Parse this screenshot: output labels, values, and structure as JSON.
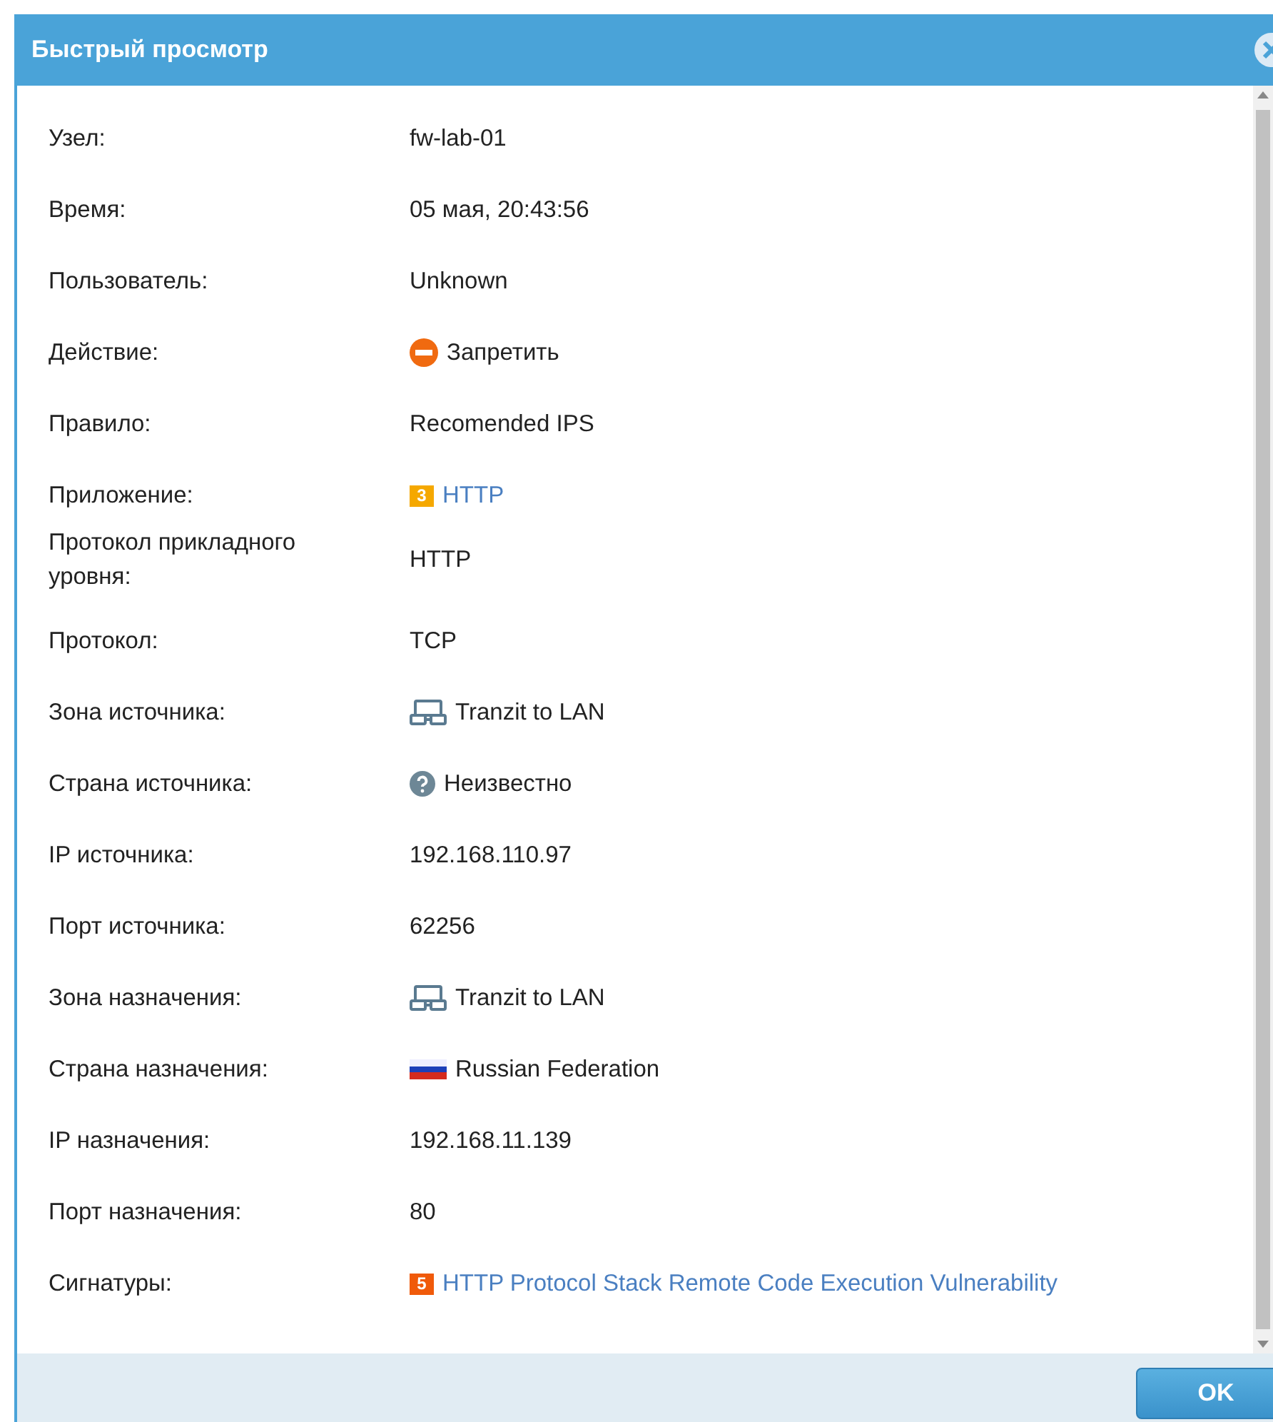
{
  "dialog": {
    "title": "Быстрый просмотр"
  },
  "fields": [
    {
      "label": "Узел:",
      "kind": "text",
      "value": "fw-lab-01"
    },
    {
      "label": "Время:",
      "kind": "text",
      "value": "05 мая, 20:43:56"
    },
    {
      "label": "Пользователь:",
      "kind": "text",
      "value": "Unknown"
    },
    {
      "label": "Действие:",
      "kind": "deny",
      "value": "Запретить"
    },
    {
      "label": "Правило:",
      "kind": "text",
      "value": "Recomended IPS"
    },
    {
      "label": "Приложение:",
      "kind": "link",
      "badge": "3",
      "color": "#f5a800",
      "value": "HTTP"
    },
    {
      "label": "Протокол прикладного уровня:",
      "kind": "text",
      "value": "HTTP"
    },
    {
      "label": "Протокол:",
      "kind": "text",
      "value": "TCP"
    },
    {
      "label": "Зона источника:",
      "kind": "zone",
      "value": "Tranzit to LAN"
    },
    {
      "label": "Страна источника:",
      "kind": "unknown",
      "value": "Неизвестно"
    },
    {
      "label": "IP источника:",
      "kind": "text",
      "value": "192.168.110.97"
    },
    {
      "label": "Порт источника:",
      "kind": "text",
      "value": "62256"
    },
    {
      "label": "Зона назначения:",
      "kind": "zone",
      "value": "Tranzit to LAN"
    },
    {
      "label": "Страна назначения:",
      "kind": "flag",
      "value": "Russian Federation"
    },
    {
      "label": "IP назначения:",
      "kind": "text",
      "value": "192.168.11.139"
    },
    {
      "label": "Порт назначения:",
      "kind": "text",
      "value": "80"
    },
    {
      "label": "Сигнатуры:",
      "kind": "link",
      "badge": "5",
      "color": "#f05a0a",
      "value": "HTTP Protocol Stack Remote Code Execution Vulnerability"
    }
  ],
  "buttons": [
    {
      "label": "OK"
    }
  ]
}
